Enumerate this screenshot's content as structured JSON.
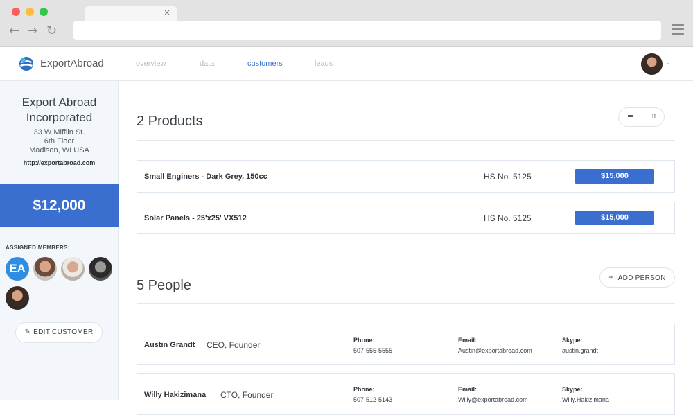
{
  "browser": {
    "tab_close": "×",
    "back": "←",
    "forward": "→",
    "reload": "↻"
  },
  "header": {
    "brand": "ExportAbroad",
    "nav": [
      {
        "label": "overview",
        "active": false
      },
      {
        "label": "data",
        "active": false
      },
      {
        "label": "customers",
        "active": true
      },
      {
        "label": "leads",
        "active": false
      }
    ],
    "caret": "⌄"
  },
  "sidebar": {
    "company_line1": "Export Abroad",
    "company_line2": "Incorporated",
    "address": [
      "33 W Mifflin St.",
      "6th Floor",
      "Madison, WI USA"
    ],
    "website": "http://exportabroad.com",
    "value": "$12,000",
    "assigned_label": "ASSIGNED MEMBERS:",
    "members": [
      {
        "initials": "EA"
      }
    ],
    "edit_label": "EDIT CUSTOMER",
    "edit_icon": "✎"
  },
  "products": {
    "title": "2 Products",
    "items": [
      {
        "name": "Small Enginers - Dark Grey, 150cc",
        "hs": "HS No. 5125",
        "price": "$15,000"
      },
      {
        "name": "Solar Panels - 25'x25' VX512",
        "hs": "HS No. 5125",
        "price": "$15,000"
      }
    ],
    "list_icon": "≡",
    "grid_icon": "⁞⁞"
  },
  "people": {
    "title": "5 People",
    "add_label": "ADD PERSON",
    "add_icon": "+",
    "labels": {
      "phone": "Phone:",
      "email": "Email:",
      "skype": "Skype:"
    },
    "items": [
      {
        "name": "Austin Grandt",
        "role": "CEO, Founder",
        "phone": "507-555-5555",
        "email": "Austin@exportabroad.com",
        "skype": "austin.grandt"
      },
      {
        "name": "Willy Hakizimana",
        "role": "CTO, Founder",
        "phone": "507-512-5143",
        "email": "Willy@exportabroad.com",
        "skype": "Willy.Hakizimana"
      }
    ]
  },
  "colors": {
    "accent": "#3a6fd0",
    "active_nav": "#3a73c9",
    "sidebar_bg": "#f3f7fb"
  }
}
